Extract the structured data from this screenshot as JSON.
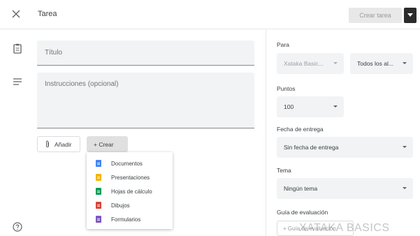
{
  "header": {
    "title": "Tarea",
    "create_label": "Crear tarea",
    "icons": {
      "close": "close-icon",
      "dropdown": "caret-down-icon"
    }
  },
  "form": {
    "title_placeholder": "Título",
    "instructions_placeholder": "Instrucciones (opcional)",
    "add_label": "Añadir",
    "new_label": "+ Crear"
  },
  "create_menu": {
    "items": [
      {
        "label": "Documentos",
        "icon": "docs-icon",
        "color": "#4285f4"
      },
      {
        "label": "Presentaciones",
        "icon": "slides-icon",
        "color": "#f4b400"
      },
      {
        "label": "Hojas de cálculo",
        "icon": "sheets-icon",
        "color": "#0f9d58"
      },
      {
        "label": "Dibujos",
        "icon": "drawings-icon",
        "color": "#db4437"
      },
      {
        "label": "Formularios",
        "icon": "forms-icon",
        "color": "#7e57c2"
      }
    ]
  },
  "panel": {
    "for_label": "Para",
    "class_value": "Xataka Basic...",
    "students_value": "Todos los al...",
    "points_label": "Puntos",
    "points_value": "100",
    "due_label": "Fecha de entrega",
    "due_value": "Sin fecha de entrega",
    "topic_label": "Tema",
    "topic_value": "Ningún tema",
    "rubric_label": "Guía de evaluación",
    "rubric_button": "+ Guía de evaluación"
  },
  "watermark": "XATAKA BASICS",
  "colors": {
    "accent_dark": "#2b2b2b",
    "field_bg": "#f1f3f4"
  }
}
